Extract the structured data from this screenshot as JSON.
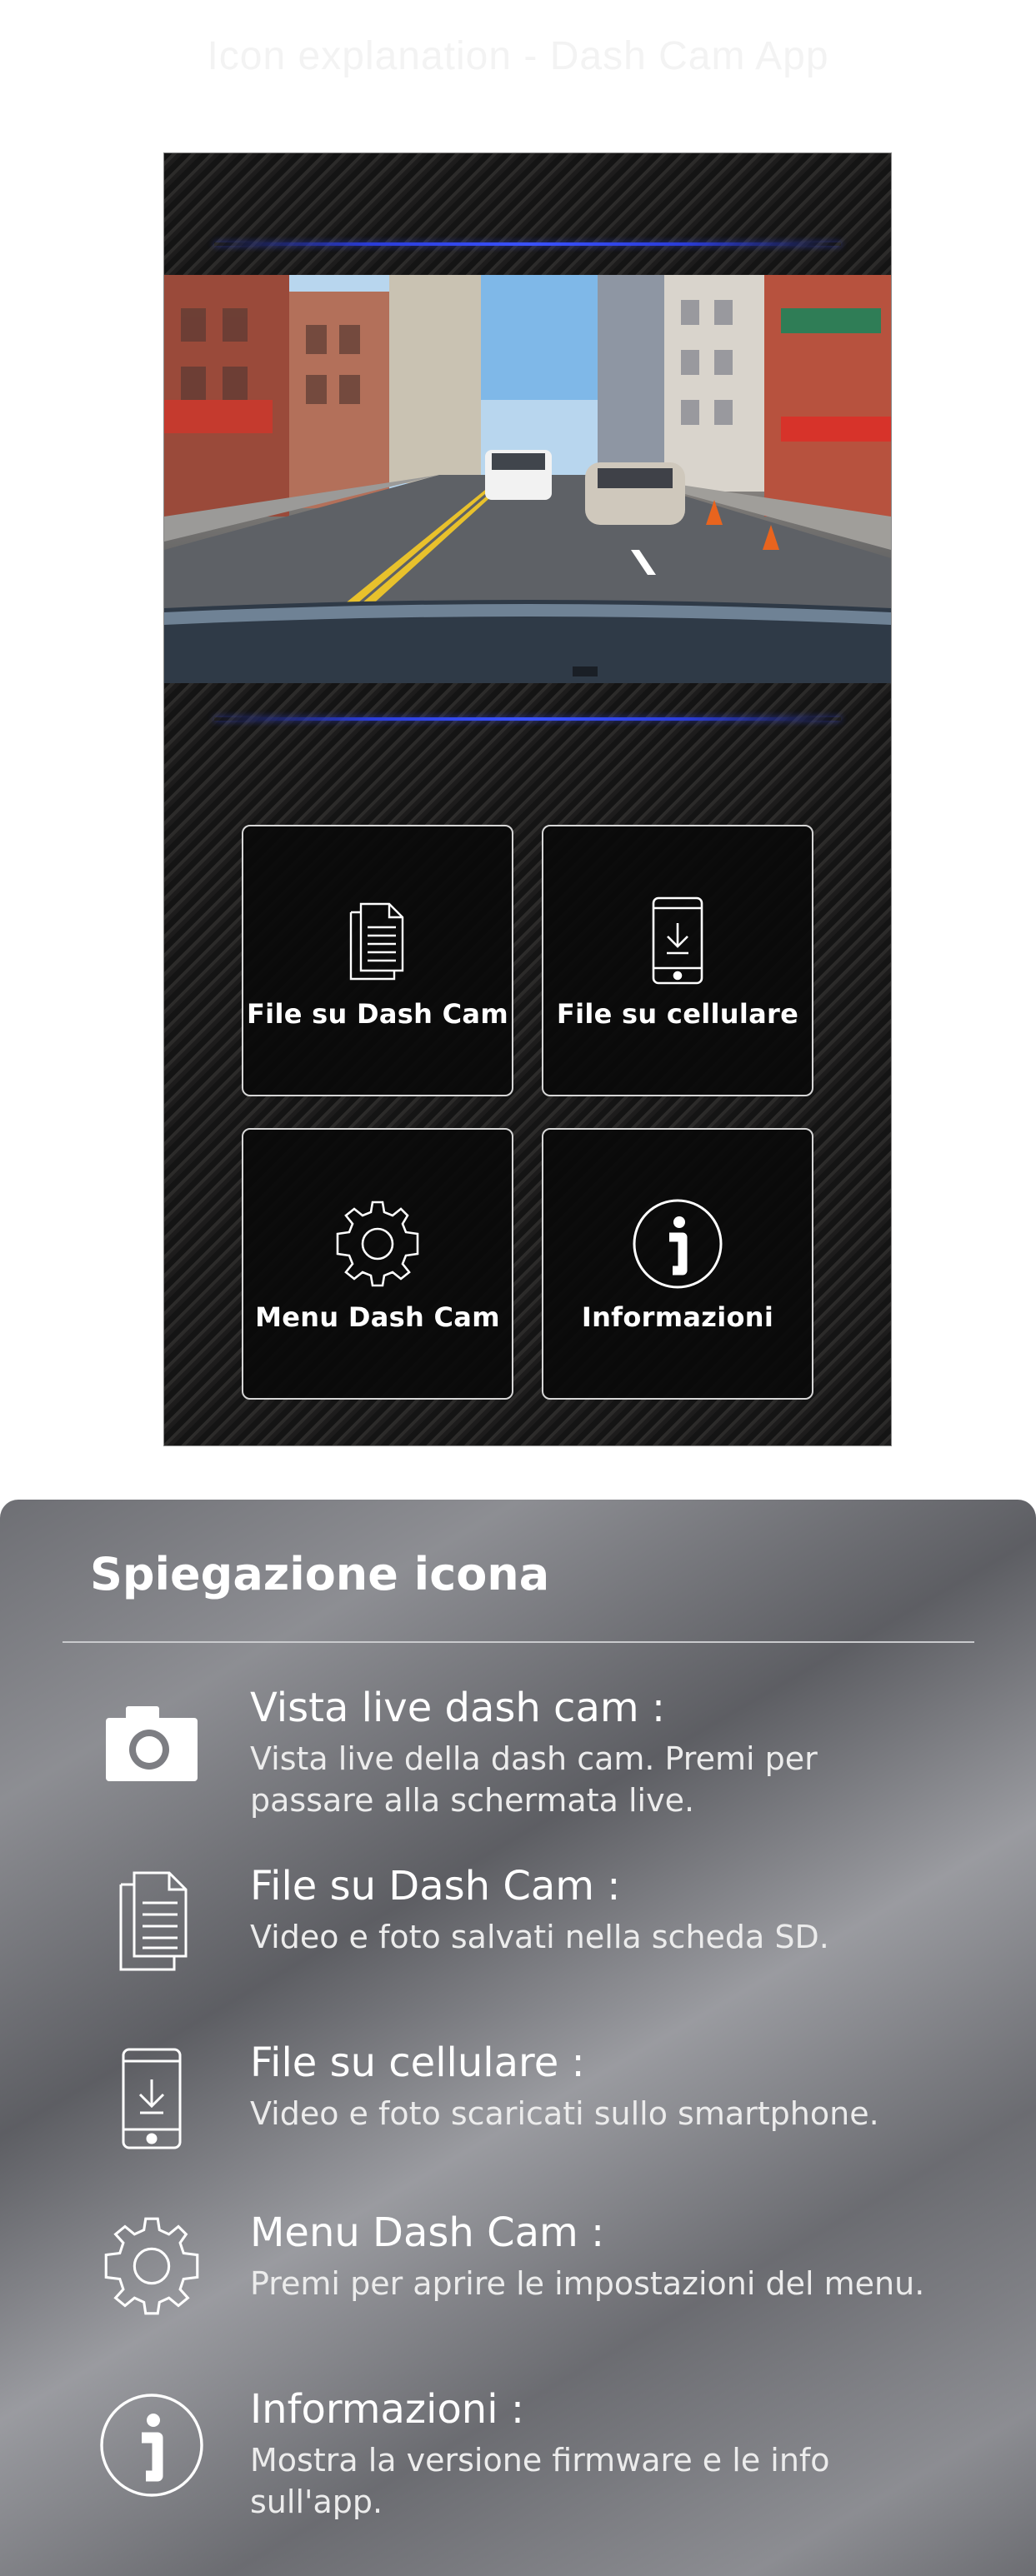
{
  "header": {
    "faint_text": "Icon explanation - Dash Cam App"
  },
  "tiles": [
    {
      "label": "File su Dash Cam",
      "icon": "documents-icon"
    },
    {
      "label": "File su cellulare",
      "icon": "phone-download-icon"
    },
    {
      "label": "Menu Dash Cam",
      "icon": "gear-icon"
    },
    {
      "label": "Informazioni",
      "icon": "info-icon"
    }
  ],
  "legend": {
    "title": "Spiegazione icona",
    "entries": [
      {
        "icon": "camera-icon",
        "title": "Vista live dash cam :",
        "desc": "Vista live della dash cam. Premi per passare alla schermata live."
      },
      {
        "icon": "documents-icon",
        "title": "File su Dash Cam :",
        "desc": "Video e foto salvati nella scheda SD."
      },
      {
        "icon": "phone-download-icon",
        "title": "File su cellulare :",
        "desc": "Video e foto scaricati sullo smartphone."
      },
      {
        "icon": "gear-icon",
        "title": "Menu Dash Cam :",
        "desc": "Premi per aprire le impostazioni del menu."
      },
      {
        "icon": "info-icon",
        "title": "Informazioni :",
        "desc": "Mostra la versione firmware e le info sull'app."
      }
    ]
  },
  "colors": {
    "accent_glow": "#3a52ff",
    "panel_bg": "#1c1c1c",
    "legend_bg": "#7d7e83"
  }
}
